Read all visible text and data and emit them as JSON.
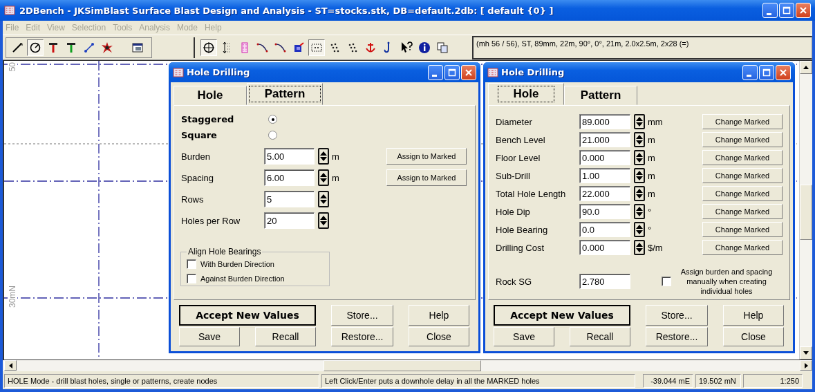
{
  "window": {
    "title": "2DBench - JKSimBlast Surface Blast Design and Analysis - ST=stocks.stk, DB=default.2db: [ default {0} ]"
  },
  "menu": [
    {
      "label": "File",
      "disabled": true
    },
    {
      "label": "Edit",
      "disabled": true
    },
    {
      "label": "View",
      "disabled": true
    },
    {
      "label": "Selection",
      "disabled": true
    },
    {
      "label": "Tools",
      "disabled": true
    },
    {
      "label": "Analysis",
      "disabled": true
    },
    {
      "label": "Mode",
      "disabled": true
    },
    {
      "label": "Help",
      "disabled": true
    }
  ],
  "toolbar": {
    "groups": [
      [
        {
          "kind": "line",
          "pressed": false
        },
        {
          "kind": "dial",
          "pressed": true
        },
        {
          "kind": "rod",
          "color": "#cc1010",
          "pressed": false
        },
        {
          "kind": "rod",
          "color": "#10a020",
          "pressed": false
        },
        {
          "kind": "stick",
          "pressed": false
        },
        {
          "kind": "burst",
          "pressed": false
        }
      ],
      [
        {
          "kind": "window",
          "pressed": false
        }
      ],
      [
        {
          "kind": "crosshair",
          "pressed": true
        },
        {
          "kind": "spacing",
          "pressed": false
        },
        {
          "kind": "frame",
          "pressed": false
        },
        {
          "kind": "curve",
          "pressed": false
        },
        {
          "kind": "curve",
          "pressed": false
        },
        {
          "kind": "cube",
          "pressed": false
        },
        {
          "kind": "select",
          "pressed": true
        },
        {
          "kind": "cluster",
          "pressed": false
        },
        {
          "kind": "cluster",
          "pressed": false
        },
        {
          "kind": "anchor",
          "pressed": false
        },
        {
          "kind": "hook",
          "pressed": false
        },
        {
          "kind": "helpcursor",
          "pressed": false
        },
        {
          "kind": "info",
          "pressed": false
        },
        {
          "kind": "copy",
          "pressed": false
        }
      ]
    ],
    "info": "(mh 56 / 56), ST, 89mm, 22m, 90°, 0°, 21m, 2.0x2.5m, 2x28 (=)"
  },
  "canvas": {
    "axis_labels": [
      "50",
      "30mN"
    ]
  },
  "dialogs": [
    {
      "kind": "pattern",
      "title": "Hole Drilling",
      "tabs": [
        {
          "label": "Hole",
          "selected": false
        },
        {
          "label": "Pattern",
          "selected": true
        }
      ],
      "layouts": [
        {
          "label": "Staggered",
          "selected": true
        },
        {
          "label": "Square",
          "selected": false
        }
      ],
      "fields": [
        {
          "label": "Burden",
          "value": "5.00",
          "unit": "m",
          "button": "Assign to Marked"
        },
        {
          "label": "Spacing",
          "value": "6.00",
          "unit": "m",
          "button": "Assign to Marked"
        },
        {
          "label": "Rows",
          "value": "5"
        },
        {
          "label": "Holes per Row",
          "value": "20"
        }
      ],
      "group": {
        "title": "Align Hole Bearings",
        "options": [
          {
            "label": "With Burden Direction",
            "checked": false
          },
          {
            "label": "Against Burden Direction",
            "checked": false
          }
        ]
      },
      "buttons": [
        {
          "label": "Accept New Values",
          "default": true
        },
        {
          "label": "Store...",
          "default": false
        },
        {
          "label": "Help",
          "default": false
        },
        {
          "label": "Save",
          "default": false
        },
        {
          "label": "Recall",
          "default": false
        },
        {
          "label": "Restore...",
          "default": false
        },
        {
          "label": "Close",
          "default": false
        }
      ]
    },
    {
      "kind": "hole",
      "title": "Hole Drilling",
      "tabs": [
        {
          "label": "Hole",
          "selected": true
        },
        {
          "label": "Pattern",
          "selected": false
        }
      ],
      "fields": [
        {
          "label": "Diameter",
          "value": "89.000",
          "unit": "mm",
          "button": "Change Marked"
        },
        {
          "label": "Bench Level",
          "value": "21.000",
          "unit": "m",
          "button": "Change Marked"
        },
        {
          "label": "Floor Level",
          "value": "0.000",
          "unit": "m",
          "button": "Change Marked"
        },
        {
          "label": "Sub-Drill",
          "value": "1.00",
          "unit": "m",
          "button": "Change Marked"
        },
        {
          "label": "Total Hole Length",
          "value": "22.000",
          "unit": "m",
          "button": "Change Marked"
        },
        {
          "label": "Hole Dip",
          "value": "90.0",
          "unit": "°",
          "button": "Change Marked"
        },
        {
          "label": "Hole Bearing",
          "value": "0.0",
          "unit": "°",
          "button": "Change Marked"
        },
        {
          "label": "Drilling Cost",
          "value": "0.000",
          "unit": "$/m",
          "button": "Change Marked"
        }
      ],
      "rock_sg": {
        "label": "Rock SG",
        "value": "2.780"
      },
      "manual_option": {
        "label": "Assign burden and spacing manually when creating individual holes",
        "checked": false
      },
      "buttons": [
        {
          "label": "Accept New Values",
          "default": true
        },
        {
          "label": "Store...",
          "default": false
        },
        {
          "label": "Help",
          "default": false
        },
        {
          "label": "Save",
          "default": false
        },
        {
          "label": "Recall",
          "default": false
        },
        {
          "label": "Restore...",
          "default": false
        },
        {
          "label": "Close",
          "default": false
        }
      ]
    }
  ],
  "status_bar": [
    "HOLE Mode - drill blast holes, single or patterns, create nodes",
    "Left Click/Enter puts a downhole delay in all the MARKED holes",
    "-39.044 mE",
    "19.502 mN",
    "1:250"
  ]
}
